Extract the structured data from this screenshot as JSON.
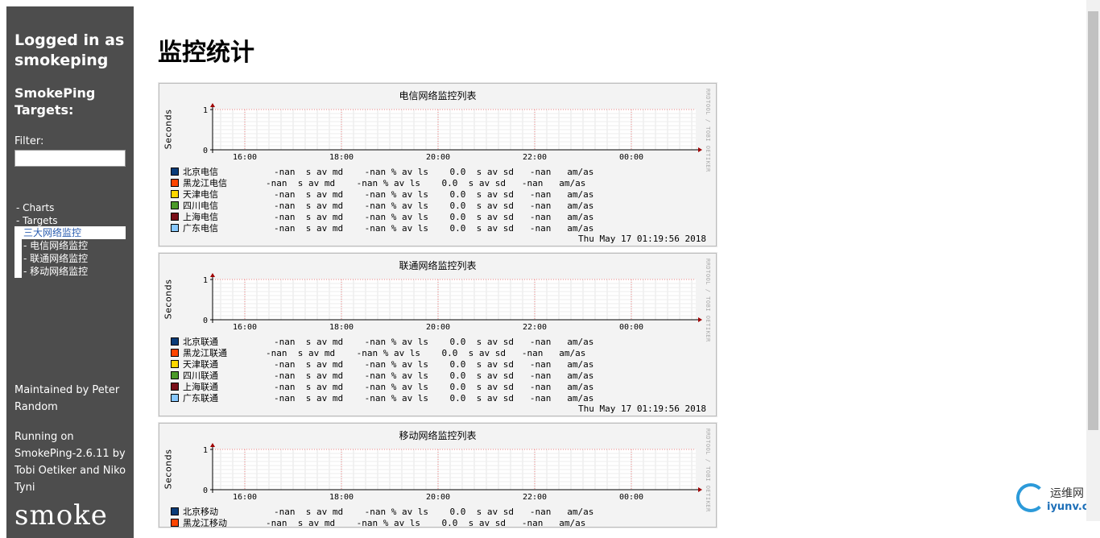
{
  "sidebar": {
    "login": "Logged in as smokeping",
    "targets_title": "SmokePing Targets:",
    "filter_label": "Filter:",
    "filter_value": "",
    "menu": [
      {
        "label": "- Charts"
      },
      {
        "label": "- Targets"
      }
    ],
    "active": "三大网络监控",
    "children": [
      {
        "label": "- 电信网络监控"
      },
      {
        "label": "- 联通网络监控"
      },
      {
        "label": "- 移动网络监控"
      }
    ],
    "maintained": "Maintained by Peter Random",
    "running": "Running on SmokePing-2.6.11 by Tobi Oetiker and Niko Tyni",
    "logo": "smoke"
  },
  "page": {
    "title": "监控统计"
  },
  "graphs": [
    {
      "title": "电信网络监控列表",
      "ylabel": "Seconds",
      "rrd": "RRDTOOL / TOBI OETIKER",
      "stamp": "Thu May 17 01:19:56 2018",
      "rows": [
        {
          "label": "北京电信",
          "stats": "     -nan  s av md    -nan % av ls    0.0  s av sd   -nan   am/as",
          "color": "#0b3c79"
        },
        {
          "label": "黑龙江电信",
          "stats": "   -nan  s av md    -nan % av ls    0.0  s av sd   -nan   am/as",
          "color": "#ff4500"
        },
        {
          "label": "天津电信",
          "stats": "     -nan  s av md    -nan % av ls    0.0  s av sd   -nan   am/as",
          "color": "#ffd700"
        },
        {
          "label": "四川电信",
          "stats": "     -nan  s av md    -nan % av ls    0.0  s av sd   -nan   am/as",
          "color": "#4c9a2a"
        },
        {
          "label": "上海电信",
          "stats": "     -nan  s av md    -nan % av ls    0.0  s av sd   -nan   am/as",
          "color": "#7a0f19"
        },
        {
          "label": "广东电信",
          "stats": "     -nan  s av md    -nan % av ls    0.0  s av sd   -nan   am/as",
          "color": "#87c8ff"
        }
      ]
    },
    {
      "title": "联通网络监控列表",
      "ylabel": "Seconds",
      "rrd": "RRDTOOL / TOBI OETIKER",
      "stamp": "Thu May 17 01:19:56 2018",
      "rows": [
        {
          "label": "北京联通",
          "stats": "     -nan  s av md    -nan % av ls    0.0  s av sd   -nan   am/as",
          "color": "#0b3c79"
        },
        {
          "label": "黑龙江联通",
          "stats": "   -nan  s av md    -nan % av ls    0.0  s av sd   -nan   am/as",
          "color": "#ff4500"
        },
        {
          "label": "天津联通",
          "stats": "     -nan  s av md    -nan % av ls    0.0  s av sd   -nan   am/as",
          "color": "#ffd700"
        },
        {
          "label": "四川联通",
          "stats": "     -nan  s av md    -nan % av ls    0.0  s av sd   -nan   am/as",
          "color": "#4c9a2a"
        },
        {
          "label": "上海联通",
          "stats": "     -nan  s av md    -nan % av ls    0.0  s av sd   -nan   am/as",
          "color": "#7a0f19"
        },
        {
          "label": "广东联通",
          "stats": "     -nan  s av md    -nan % av ls    0.0  s av sd   -nan   am/as",
          "color": "#87c8ff"
        }
      ]
    },
    {
      "title": "移动网络监控列表",
      "ylabel": "Seconds",
      "rrd": "RRDTOOL / TOBI OETIKER",
      "stamp": "",
      "rows": [
        {
          "label": "北京移动",
          "stats": "     -nan  s av md    -nan % av ls    0.0  s av sd   -nan   am/as",
          "color": "#0b3c79"
        },
        {
          "label": "黑龙江移动",
          "stats": "   -nan  s av md    -nan % av ls    0.0  s av sd   -nan   am/as",
          "color": "#ff4500"
        }
      ]
    }
  ],
  "axis": {
    "y_ticks": [
      "1",
      "0"
    ],
    "x_ticks": [
      "16:00",
      "18:00",
      "20:00",
      "22:00",
      "00:00"
    ]
  },
  "watermark": {
    "cn": "运维网",
    "en": "iyunv.com"
  }
}
